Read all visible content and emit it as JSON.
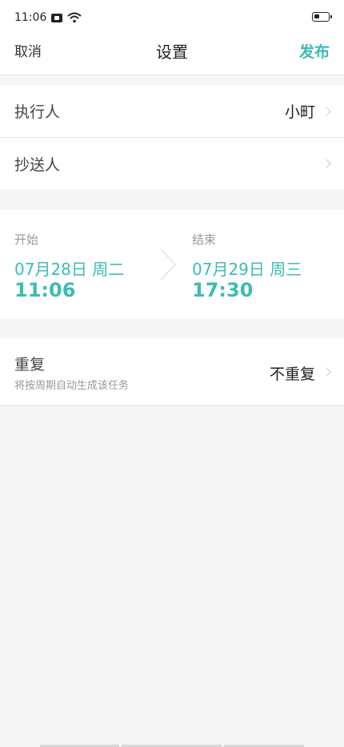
{
  "status_bar": {
    "time": "11:06",
    "icons": [
      "message-icon",
      "wifi-icon",
      "battery-icon"
    ]
  },
  "nav": {
    "cancel": "取消",
    "title": "设置",
    "publish": "发布"
  },
  "assignees": {
    "executor_label": "执行人",
    "executor_value": "小町",
    "cc_label": "抄送人",
    "cc_value": ""
  },
  "time": {
    "start_caption": "开始",
    "start_date": "07月28日 周二",
    "start_time": "11:06",
    "end_caption": "结束",
    "end_date": "07月29日 周三",
    "end_time": "17:30"
  },
  "repeat": {
    "label": "重复",
    "subtitle": "将按周期自动生成该任务",
    "value": "不重复"
  },
  "colors": {
    "accent": "#3bbcb4",
    "background": "#f5f5f5",
    "card": "#ffffff"
  }
}
